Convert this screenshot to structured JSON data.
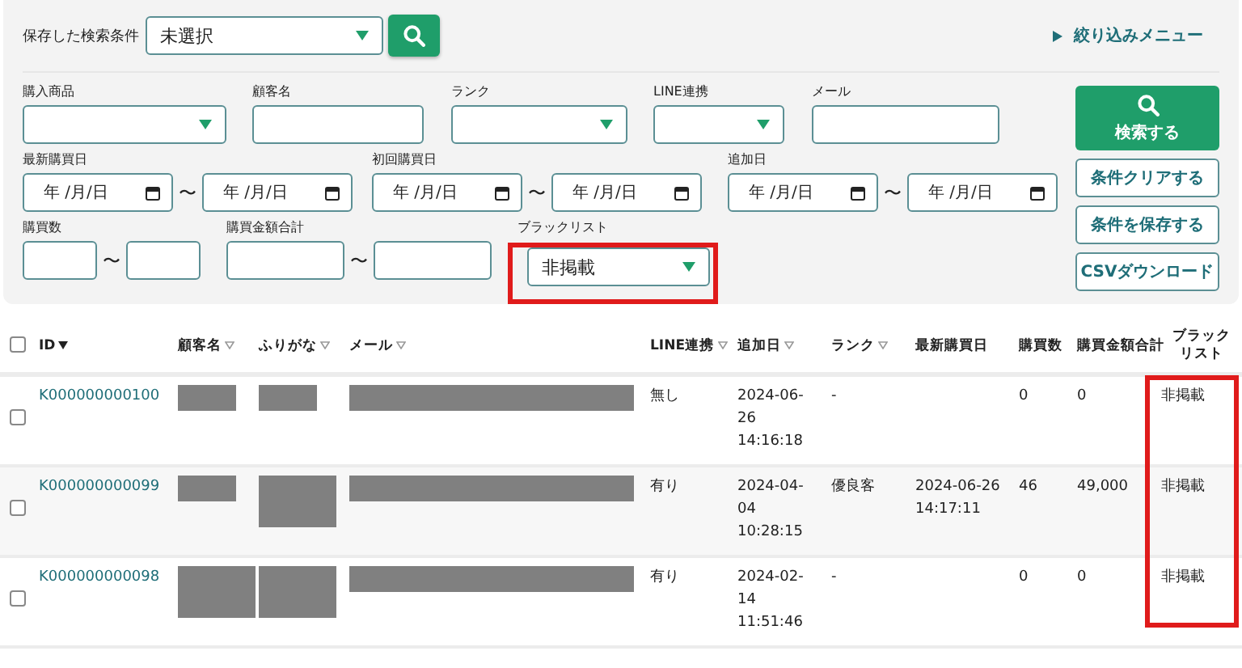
{
  "saved_search": {
    "label": "保存した検索条件",
    "value": "未選択"
  },
  "filter_menu": {
    "label": "絞り込みメニュー",
    "expanded": false
  },
  "filters": [
    [
      {
        "kind": "select",
        "label": "購入商品"
      },
      {
        "kind": "text",
        "label": "顧客名"
      },
      {
        "kind": "select",
        "label": "ランク"
      },
      {
        "kind": "select",
        "label": "LINE連携"
      },
      {
        "kind": "text",
        "label": "メール"
      }
    ],
    [
      {
        "kind": "date_range",
        "label": "最新購買日",
        "from": "年 /月/日",
        "to": "年 /月/日",
        "separator": "〜"
      },
      {
        "kind": "date_range",
        "label": "初回購買日",
        "from": "年 /月/日",
        "to": "年 /月/日",
        "separator": "〜"
      },
      {
        "kind": "date_range",
        "label": "追加日",
        "from": "年 /月/日",
        "to": "年 /月/日",
        "separator": "〜"
      }
    ],
    [
      {
        "kind": "number_range",
        "label": "購買数",
        "separator": "〜"
      },
      {
        "kind": "number_range",
        "label": "購買金額合計",
        "separator": "〜"
      },
      {
        "kind": "select",
        "label": "ブラックリスト",
        "value": "非掲載",
        "highlighted": true
      }
    ]
  ],
  "buttons": [
    {
      "kind": "primary",
      "label": "検索する"
    },
    {
      "kind": "secondary",
      "label": "条件クリアする"
    },
    {
      "kind": "secondary",
      "label": "条件を保存する"
    },
    {
      "kind": "secondary",
      "label": "CSVダウンロード"
    }
  ],
  "table": {
    "all_selected": false,
    "columns": [
      {
        "label": "ID",
        "sortable": true,
        "sorted": true
      },
      {
        "label": "顧客名",
        "sortable": true,
        "sorted": false
      },
      {
        "label": "ふりがな",
        "sortable": true,
        "sorted": false
      },
      {
        "label": "メール",
        "sortable": true,
        "sorted": false
      },
      {
        "label": "LINE連携",
        "sortable": true,
        "sorted": false
      },
      {
        "label": "追加日",
        "sortable": true,
        "sorted": false
      },
      {
        "label": "ランク",
        "sortable": true,
        "sorted": false
      },
      {
        "label": "最新購買日"
      },
      {
        "label": "購買数"
      },
      {
        "label": "購買金額合計"
      },
      {
        "label": "ブラックリスト",
        "highlighted": true
      }
    ],
    "rows": [
      {
        "selected": false,
        "cells": [
          {
            "kind": "link",
            "text": "K000000000100"
          },
          {
            "kind": "redacted",
            "tall": false
          },
          {
            "kind": "redacted",
            "tall": false
          },
          {
            "kind": "redacted_line"
          },
          {
            "kind": "text",
            "text": "無し"
          },
          {
            "kind": "text",
            "text": "2024-06-26 14:16:18"
          },
          {
            "kind": "text",
            "text": "-"
          },
          {
            "kind": "blank"
          },
          {
            "kind": "text",
            "text": "0"
          },
          {
            "kind": "text",
            "text": "0"
          },
          {
            "kind": "text",
            "text": "非掲載"
          }
        ]
      },
      {
        "selected": false,
        "cells": [
          {
            "kind": "link",
            "text": "K000000000099"
          },
          {
            "kind": "redacted",
            "tall": false
          },
          {
            "kind": "redacted",
            "tall": true
          },
          {
            "kind": "redacted_line"
          },
          {
            "kind": "text",
            "text": "有り"
          },
          {
            "kind": "text",
            "text": "2024-04-04 10:28:15"
          },
          {
            "kind": "text",
            "text": "優良客"
          },
          {
            "kind": "text",
            "text": "2024-06-26 14:17:11"
          },
          {
            "kind": "text",
            "text": "46"
          },
          {
            "kind": "text",
            "text": "49,000"
          },
          {
            "kind": "text",
            "text": "非掲載"
          }
        ]
      },
      {
        "selected": false,
        "cells": [
          {
            "kind": "link",
            "text": "K000000000098"
          },
          {
            "kind": "redacted",
            "tall": true
          },
          {
            "kind": "redacted",
            "tall": true
          },
          {
            "kind": "redacted_line"
          },
          {
            "kind": "text",
            "text": "有り"
          },
          {
            "kind": "text",
            "text": "2024-02-14 11:51:46"
          },
          {
            "kind": "text",
            "text": "-"
          },
          {
            "kind": "blank"
          },
          {
            "kind": "text",
            "text": "0"
          },
          {
            "kind": "text",
            "text": "0"
          },
          {
            "kind": "text",
            "text": "非掲載"
          }
        ]
      }
    ]
  }
}
